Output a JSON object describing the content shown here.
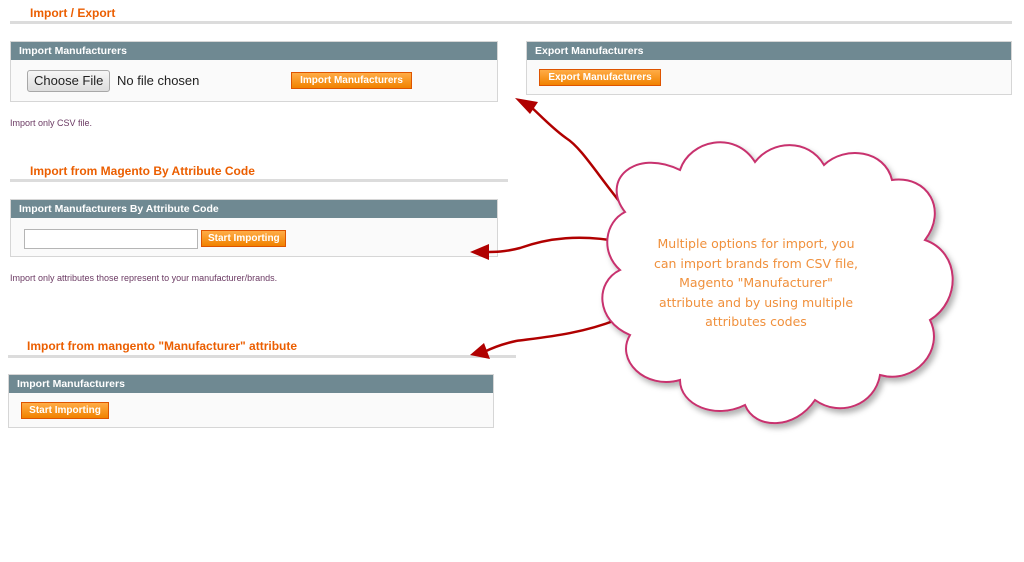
{
  "import_export": {
    "title": "Import / Export",
    "import_box": {
      "header": "Import Manufacturers",
      "choose_file_label": "Choose File",
      "file_status": "No file chosen",
      "button": "Import Manufacturers",
      "note": "Import only CSV file."
    },
    "export_box": {
      "header": "Export Manufacturers",
      "button": "Export Manufacturers"
    }
  },
  "by_attribute": {
    "title": "Import from Magento By Attribute Code",
    "box": {
      "header": "Import Manufacturers By Attribute Code",
      "input_value": "",
      "button": "Start Importing"
    },
    "note": "Import only attributes those represent to your manufacturer/brands."
  },
  "from_manufacturer": {
    "title": "Import from mangento \"Manufacturer\" attribute",
    "box": {
      "header": "Import Manufacturers",
      "button": "Start Importing"
    }
  },
  "callout": {
    "lines": [
      "Multiple options for import, you",
      "can import brands from CSV file,",
      "Magento \"Manufacturer\"",
      "attribute and by using multiple",
      "attributes codes"
    ]
  },
  "colors": {
    "accent_orange": "#eb5e00",
    "header_slate": "#6f8992",
    "arrow_red": "#b00000",
    "cloud_border": "#c8306e",
    "callout_text": "#f0903c"
  }
}
